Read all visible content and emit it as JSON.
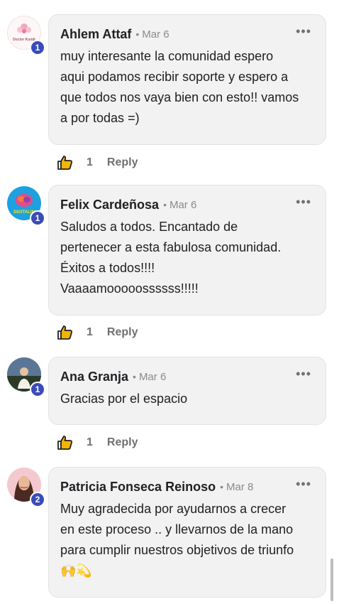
{
  "comments": [
    {
      "author": "Ahlem Attaf",
      "date": "Mar 6",
      "level": "1",
      "text": "muy interesante la comunidad espero\naqui podamos recibir soporte y espero a\nque todos nos vaya bien con esto!! vamos\na por todas =)",
      "likes": "1",
      "avatar_label": "Doctor Kundi"
    },
    {
      "author": "Felix Cardeñosa",
      "date": "Mar 6",
      "level": "1",
      "text": "Saludos a todos. Encantado de\npertenecer a esta fabulosa comunidad.\nÉxitos a todos!!!!\nVaaaamooooossssss!!!!!",
      "likes": "1",
      "avatar_label": "DIGITALIN"
    },
    {
      "author": "Ana Granja",
      "date": "Mar 6",
      "level": "1",
      "text": "Gracias por el espacio",
      "likes": "1",
      "avatar_label": ""
    },
    {
      "author": "Patricia Fonseca Reinoso",
      "date": "Mar 8",
      "level": "2",
      "text": "Muy agradecida por ayudarnos a crecer\nen este proceso .. y llevarnos de la mano\npara cumplir nuestros objetivos de triunfo",
      "emoji": "🙌💫",
      "likes": "",
      "avatar_label": ""
    }
  ],
  "reply_label": "Reply",
  "more_label": "•••",
  "dot": "•",
  "colors": {
    "bubble_bg": "#f2f2f2",
    "badge": "#3b4cb8",
    "muted_text": "#707070",
    "like_icon": "#e8a400"
  }
}
